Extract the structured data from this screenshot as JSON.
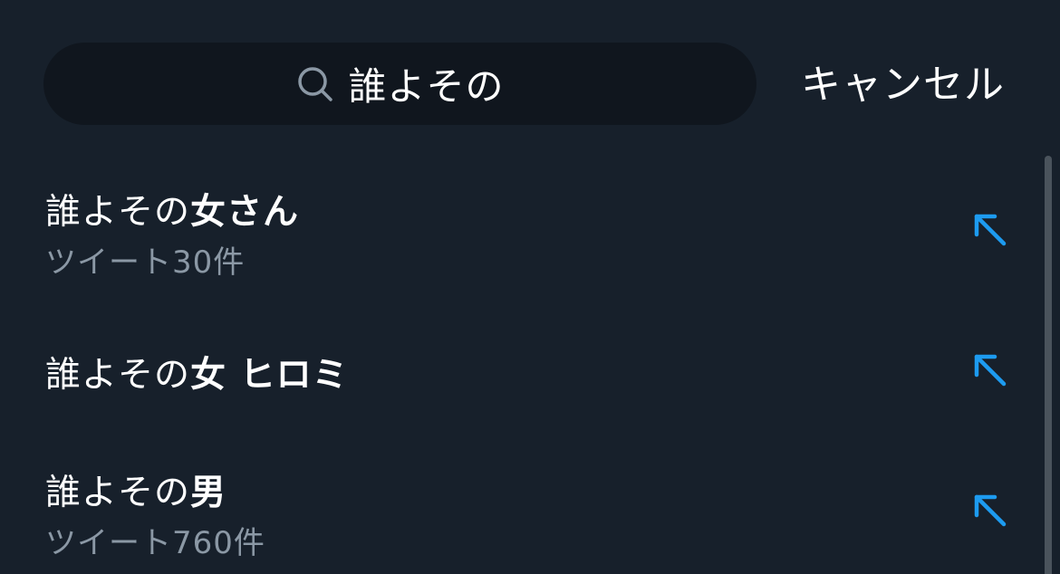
{
  "search": {
    "query": "誰よその"
  },
  "header": {
    "cancel_label": "キャンセル"
  },
  "suggestions": [
    {
      "prefix": "誰よその",
      "match": "女さん",
      "subtitle": "ツイート30件"
    },
    {
      "prefix": "誰よその",
      "match": "女 ヒロミ",
      "subtitle": ""
    },
    {
      "prefix": "誰よその",
      "match": "男",
      "subtitle": "ツイート760件"
    }
  ],
  "colors": {
    "background": "#17202b",
    "search_field": "#10161e",
    "secondary_text": "#8b98a5",
    "accent_arrow": "#1d9bf0"
  },
  "icons": {
    "search": "search-icon",
    "fill_arrow": "arrow-up-left-icon"
  }
}
